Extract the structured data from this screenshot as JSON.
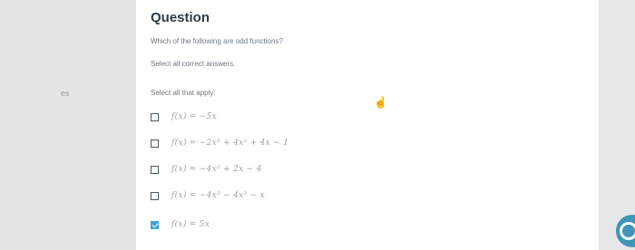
{
  "sidebar": {
    "partial_text": "es"
  },
  "question": {
    "title": "Question",
    "prompt": "Which of the following are odd functions?",
    "instruction": "Select all correct answers.",
    "select_hint": "Select all that apply:"
  },
  "options": [
    {
      "text": "f(x) = −5x",
      "checked": false
    },
    {
      "text": "f(x) = −2x³ + 4x² + 4x − 1",
      "checked": false
    },
    {
      "text": "f(x) = −4x² + 2x − 4",
      "checked": false
    },
    {
      "text": "f(x) = −4x⁵ − 4x³ − x",
      "checked": false
    },
    {
      "text": "f(x) = 5x",
      "checked": true
    }
  ],
  "icons": {
    "cursor": "hand-pointer-icon",
    "chat": "chat-icon"
  },
  "colors": {
    "accent": "#3fa4d8",
    "chat": "#3e95b8"
  }
}
